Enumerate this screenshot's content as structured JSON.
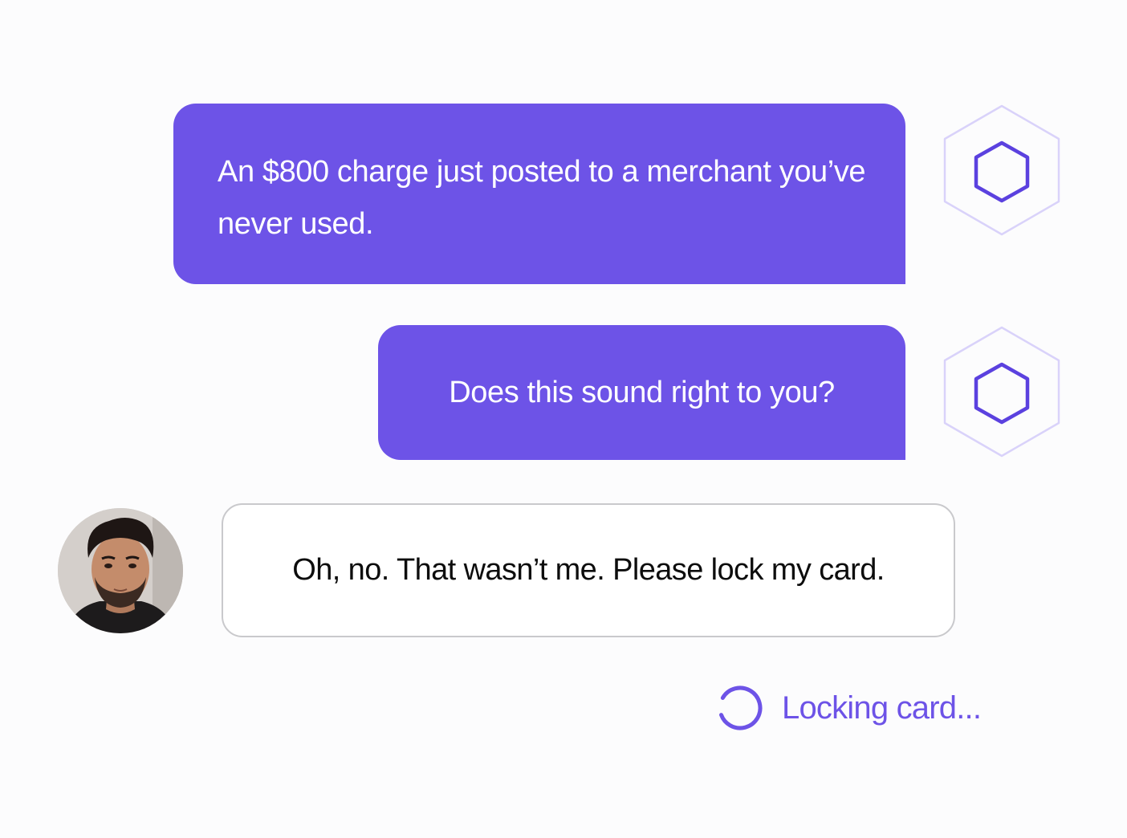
{
  "conversation": {
    "messages": [
      {
        "sender": "agent",
        "text": "An $800 charge just posted to a merchant you’ve never used."
      },
      {
        "sender": "agent",
        "text": "Does this sound right to you?"
      },
      {
        "sender": "user",
        "text": "Oh, no. That wasn’t me. Please lock my card."
      }
    ]
  },
  "status": {
    "text": "Locking card...",
    "icon": "loading-spinner-icon"
  },
  "colors": {
    "accent": "#6d53e7",
    "agent_bubble": "#6d53e7",
    "hexagon_outline_light": "#d9d2fa",
    "hexagon_outline_dark": "#5b41df",
    "user_bubble_border": "#c9c9cc",
    "background": "#fcfcfd"
  }
}
